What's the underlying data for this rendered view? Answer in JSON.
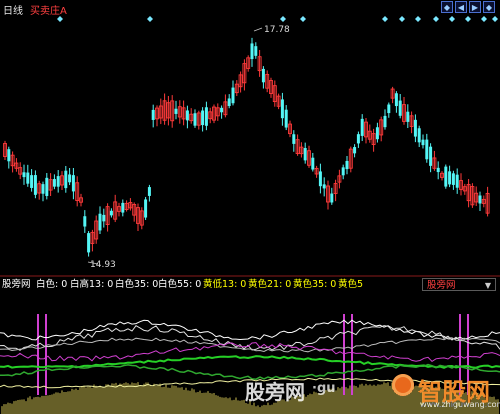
{
  "header": {
    "period": "日线",
    "indicator_name": "买卖庄A",
    "nav_buttons": [
      {
        "icon": "skip-start-icon",
        "glyph": "◆"
      },
      {
        "icon": "prev-icon",
        "glyph": "◀"
      },
      {
        "icon": "next-icon",
        "glyph": "▶"
      },
      {
        "icon": "skip-end-icon",
        "glyph": "◆"
      }
    ]
  },
  "price_chart": {
    "high_label": "17.78",
    "low_label": "14.93"
  },
  "legend": {
    "items": [
      {
        "text": "股旁网",
        "color": "#ffffff"
      },
      {
        "text": "白色: 0",
        "color": "#ffffff"
      },
      {
        "text": "白高13: 0",
        "color": "#ffffff"
      },
      {
        "text": "白色35: 0",
        "color": "#ffffff"
      },
      {
        "text": "白色55: 0",
        "color": "#ffffff"
      },
      {
        "text": "黄低13: 0",
        "color": "#ffff00"
      },
      {
        "text": "黄色21: 0",
        "color": "#ffff00"
      },
      {
        "text": "黄色35: 0",
        "color": "#ffff00"
      },
      {
        "text": "黄色5",
        "color": "#ffff00"
      }
    ],
    "tab_label": "股旁网"
  },
  "watermark": {
    "left": "股旁网",
    "mid": "·gu",
    "right": "智股网",
    "url": "www.zhiguwang.com"
  },
  "colors": {
    "up": "#ff3a3a",
    "down": "#54f6f6",
    "signal": "#7ae8ff",
    "magenta": "#d040d0",
    "green": "#26d026",
    "yellow": "#f0e060"
  }
}
